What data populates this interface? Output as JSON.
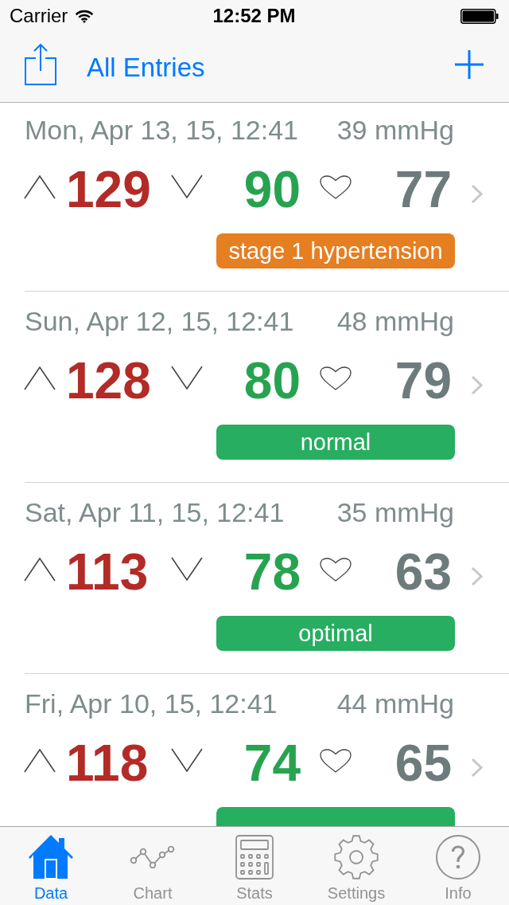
{
  "status_bar": {
    "carrier": "Carrier",
    "time": "12:52 PM"
  },
  "nav_bar": {
    "title": "All Entries"
  },
  "entries": [
    {
      "date": "Mon, Apr 13, 15, 12:41",
      "pressure": "39 mmHg",
      "systolic": "129",
      "diastolic": "90",
      "pulse": "77",
      "category": {
        "label": "stage 1 hypertension",
        "color": "#e67e22"
      }
    },
    {
      "date": "Sun, Apr 12, 15, 12:41",
      "pressure": "48 mmHg",
      "systolic": "128",
      "diastolic": "80",
      "pulse": "79",
      "category": {
        "label": "normal",
        "color": "#27ae60"
      }
    },
    {
      "date": "Sat, Apr 11, 15, 12:41",
      "pressure": "35 mmHg",
      "systolic": "113",
      "diastolic": "78",
      "pulse": "63",
      "category": {
        "label": "optimal",
        "color": "#27ae60"
      }
    },
    {
      "date": "Fri, Apr 10, 15, 12:41",
      "pressure": "44 mmHg",
      "systolic": "118",
      "diastolic": "74",
      "pulse": "65",
      "category": {
        "color": "#27ae60"
      }
    }
  ],
  "tab_bar": {
    "items": [
      {
        "label": "Data",
        "selected": true
      },
      {
        "label": "Chart",
        "selected": false
      },
      {
        "label": "Stats",
        "selected": false
      },
      {
        "label": "Settings",
        "selected": false
      },
      {
        "label": "Info",
        "selected": false
      }
    ]
  }
}
